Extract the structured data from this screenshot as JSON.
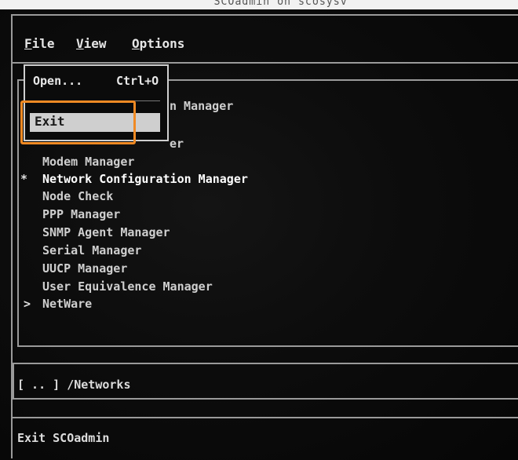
{
  "window": {
    "title": "SCOadmin on scosysv"
  },
  "menubar": {
    "items": [
      {
        "first": "F",
        "rest": "ile"
      },
      {
        "first": "V",
        "rest": "iew"
      },
      {
        "first": "O",
        "rest": "ptions"
      }
    ]
  },
  "file_menu": {
    "open_label": "Open...",
    "open_shortcut": "Ctrl+O",
    "exit_label": "Exit"
  },
  "list": {
    "partial_1": "n Manager",
    "partial_2": "er",
    "selected_marker": "*",
    "folder_marker": ">",
    "items": [
      "Modem Manager",
      "Network Configuration Manager",
      "Node Check",
      "PPP Manager",
      "SNMP Agent Manager",
      "Serial Manager",
      "UUCP Manager",
      "User Equivalence Manager",
      "NetWare"
    ]
  },
  "path": {
    "text": "[ .. ] /Networks"
  },
  "status": {
    "text": "Exit SCOadmin"
  },
  "colors": {
    "highlight": "#f08a24",
    "selection_bg": "#cfcfcf"
  }
}
